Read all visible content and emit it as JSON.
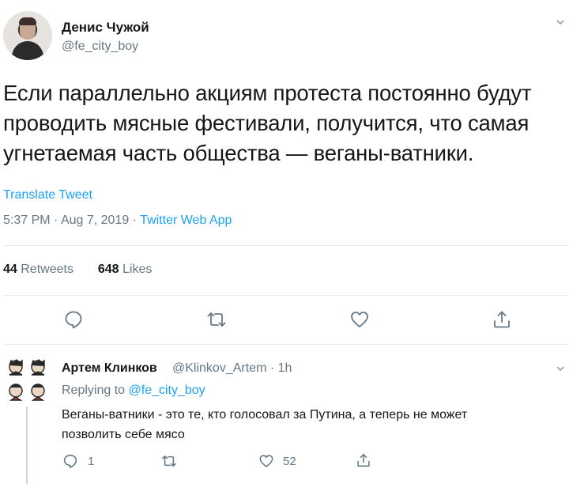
{
  "tweet": {
    "author_name": "Денис Чужой",
    "author_handle": "@fe_city_boy",
    "text_lines": [
      "Если параллельно акциям протеста постоянно будут",
      "проводить мясные фестивали, получится, что самая",
      "угнетаемая часть общества — веганы-ватники."
    ],
    "translate_label": "Translate Tweet",
    "time": "5:37 PM",
    "date": "Aug 7, 2019",
    "separator": "·",
    "source_app": "Twitter Web App",
    "retweets_count": "44",
    "retweets_label": "Retweets",
    "likes_count": "648",
    "likes_label": "Likes"
  },
  "reply": {
    "author_name": "Артем Клинков",
    "author_handle": "@Klinkov_Artem · 1h",
    "replying_prefix": "Replying to",
    "replying_to": "@fe_city_boy",
    "text_lines": [
      "Веганы-ватники - это те, кто голосовал за Путина, а теперь не может",
      "позволить себе мясо"
    ],
    "reply_count": "1",
    "retweet_count": "",
    "like_count": "52"
  },
  "icons": {
    "reply": "comment-bubble-icon",
    "retweet": "retweet-arrows-icon",
    "like": "heart-icon",
    "share": "share-upload-icon",
    "more": "chevron-down-icon"
  },
  "colors": {
    "link": "#1da1f2",
    "muted": "#657786",
    "text": "#14171a",
    "divider": "#e6ecf0"
  }
}
